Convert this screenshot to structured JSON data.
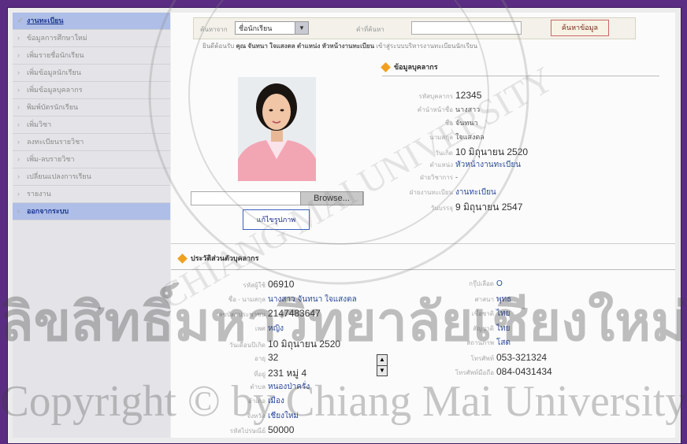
{
  "sidebar": {
    "items": [
      {
        "label": "งานทะเบียน",
        "kind": "header"
      },
      {
        "label": "ข้อมูลการศึกษาใหม่",
        "kind": "normal"
      },
      {
        "label": "เพิ่มรายชื่อนักเรียน",
        "kind": "normal"
      },
      {
        "label": "เพิ่มข้อมูลนักเรียน",
        "kind": "normal"
      },
      {
        "label": "เพิ่มข้อมูลบุคลากร",
        "kind": "normal"
      },
      {
        "label": "พิมพ์บัตรนักเรียน",
        "kind": "normal"
      },
      {
        "label": "เพิ่มวิชา",
        "kind": "normal"
      },
      {
        "label": "ลงทะเบียนรายวิชา",
        "kind": "normal"
      },
      {
        "label": "เพิ่ม-ลบรายวิชา",
        "kind": "normal"
      },
      {
        "label": "เปลี่ยนแปลงการเรียน",
        "kind": "normal"
      },
      {
        "label": "รายงาน",
        "kind": "normal"
      },
      {
        "label": "ออกจากระบบ",
        "kind": "active"
      }
    ]
  },
  "search": {
    "label_type": "ค้นหาจาก",
    "type_value": "ชื่อนักเรียน",
    "label_keyword": "คำที่ค้นหา",
    "keyword_value": "",
    "button_label": "ค้นหาข้อมูล"
  },
  "welcome": {
    "prefix": "ยินดีต้อนรับ",
    "name": "คุณ จันทนา ใจแสงตล",
    "position": "ตำแหน่ง หัวหน้างานทะเบียน",
    "suffix": "เข้าสู่ระบบบริหารงานทะเบียนนักเรียน"
  },
  "upload": {
    "file_value": "",
    "browse_label": "Browse...",
    "edit_button_label": "แก้ไขรูปภาพ"
  },
  "staff": {
    "title": "ข้อมูลบุคลากร",
    "fields": [
      {
        "label": "รหัสบุคลากร",
        "value": "12345",
        "style": "num"
      },
      {
        "label": "คำนำหน้าชื่อ",
        "value": "นางสาว",
        "style": "th"
      },
      {
        "label": "ชื่อ",
        "value": "จันทนา",
        "style": "th"
      },
      {
        "label": "นามสกุล",
        "value": "ใจแสงตล",
        "style": "th"
      },
      {
        "label": "วันเกิด",
        "value": "10 มิถุนายน 2520",
        "style": "num"
      },
      {
        "label": "ตำแหน่ง",
        "value": "หัวหน้างานทะเบียน",
        "style": "bold"
      },
      {
        "label": "ฝ่ายวิชาการ",
        "value": "-",
        "style": "th"
      },
      {
        "label": "ฝ่ายงานทะเบียน",
        "value": "งานทะเบียน",
        "style": "bold"
      },
      {
        "label": "วันบรรจุ",
        "value": "9 มิถุนายน 2547",
        "style": "num"
      }
    ]
  },
  "history": {
    "title": "ประวัติส่วนตัวบุคลากร",
    "left": [
      {
        "label": "รหัสผู้ใช้",
        "value": "06910",
        "style": "num"
      },
      {
        "label": "ชื่อ - นามสกุล",
        "value": "นางสาว จันทนา ใจแสงตล",
        "style": "bold"
      },
      {
        "label": "เลขบัตรประชาชน",
        "value": "2147483647",
        "style": "num"
      },
      {
        "label": "เพศ",
        "value": "หญิง",
        "style": "bold"
      },
      {
        "label": "วันเดือนปีเกิด",
        "value": "10 มิถุนายน 2520",
        "style": "num"
      },
      {
        "label": "อายุ",
        "value": "32",
        "style": "num"
      },
      {
        "label": "ที่อยู่",
        "value": "231 หมู่ 4",
        "style": "num"
      },
      {
        "label": "ตำบล",
        "value": "หนองป่าครั่ง",
        "style": "bold"
      },
      {
        "label": "อำเภอ",
        "value": "เมือง",
        "style": "bold"
      },
      {
        "label": "จังหวัด",
        "value": "เชียงใหม่",
        "style": "bold"
      },
      {
        "label": "รหัสไปรษณีย์",
        "value": "50000",
        "style": "num"
      }
    ],
    "right": [
      {
        "label": "กรุ๊ปเลือด",
        "value": "O",
        "style": "bold"
      },
      {
        "label": "ศาสนา",
        "value": "พุทธ",
        "style": "bold"
      },
      {
        "label": "เชื้อชาติ",
        "value": "ไทย",
        "style": "bold"
      },
      {
        "label": "สัญชาติ",
        "value": "ไทย",
        "style": "bold"
      },
      {
        "label": "สถานภาพ",
        "value": "โสด",
        "style": "bold"
      },
      {
        "label": "โทรศัพท์",
        "value": "053-321324",
        "style": "num"
      },
      {
        "label": "โทรศัพท์มือถือ",
        "value": "084-0431434",
        "style": "num"
      }
    ],
    "scroll_up": "▲",
    "scroll_down": "▼"
  },
  "watermark": {
    "thai": "ลิขสิทธิ์มหาวิทยาลัยเชียงใหม่",
    "eng": "Copyright © by Chiang Mai University",
    "seal_text": "CHIANG MAI UNIVERSITY"
  },
  "colors": {
    "outer": "#5a2d82",
    "sidebar_header": "#aebee6",
    "accent_blue": "#1f3a93",
    "diamond": "#f0a020"
  }
}
